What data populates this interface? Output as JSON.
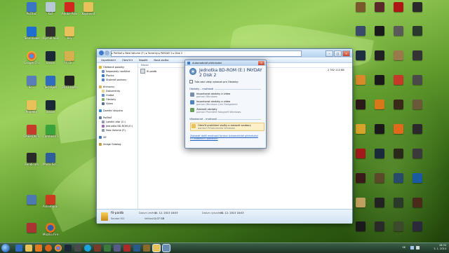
{
  "explorer": {
    "address": "▸ Počítač ▸ New Volume (F:) ▸ Torrenty ▸ PAYDAY 2 ▸ Disk 2",
    "commands": [
      "Uspořádat ▾",
      "Otevřít ▾",
      "Napálit",
      "Nová složka"
    ],
    "nav": [
      "Oblíbené položky",
      "Naposledy navštíve",
      "Plocha",
      "Stažené soubory",
      "Knihovny",
      "Dokumenty",
      "Hudba",
      "Obrázky",
      "Videa",
      "Domácí skupina",
      "Počítač",
      "Lokální disk (C:)",
      "Jednotka BD-ROM (E:)",
      "New Volume (F:)",
      "Síť",
      "Image Catalog"
    ],
    "column_name": "Název",
    "file_name": "fil-paidb",
    "size": "2 352 110 KB",
    "status": {
      "name": "fil-paidb",
      "modified_label": "Datum změny:",
      "modified": "31. 12. 2013 18:03",
      "created_label": "Datum vytvoření:",
      "created": "31. 12. 2013 18:03",
      "type_label": "Soubor ISO",
      "size_label": "Velikost:",
      "size": "2,07 GB"
    }
  },
  "autoplay": {
    "title": "Automatické přehrávání",
    "drive": "Jednotka BD-ROM (E:) PAYDAY 2 Disk 2",
    "always": "Tuto akci vždy vykonat pro Obrázky:",
    "section1": "Obrázky – možnosti",
    "options": [
      {
        "title": "Importovat obrázky a videa",
        "sub": "pomocí Windows"
      },
      {
        "title": "Importovat obrázky a videa",
        "sub": "pomocí Windows Live Fotogalerie"
      },
      {
        "title": "Zobrazit obrázky",
        "sub": "pomocí Prohlížeč fotografií Windows"
      }
    ],
    "section2": "Všeobecné – možnosti",
    "general": {
      "title": "Otevřít prohlížení složky a zobrazit soubory",
      "sub": "pomocí Průzkumníka Windows"
    },
    "link": "Zobrazit další možnosti funkce Automatické přehrávání v Ovládacích panelech"
  },
  "desktop_icons": [
    {
      "label": "Počítač"
    },
    {
      "label": "Koš"
    },
    {
      "label": "Adobe Reader"
    },
    {
      "label": "Kopírovat"
    },
    {
      "label": "TeamViewer"
    },
    {
      "label": "Rychlé hudby"
    },
    {
      "label": "Hry"
    },
    {
      "label": "Google Chrome"
    },
    {
      "label": "Steam"
    },
    {
      "label": "FC Dr..."
    },
    {
      "label": "Sc..."
    },
    {
      "label": "TechSpot"
    },
    {
      "label": "2013 klášter"
    },
    {
      "label": "Projekty"
    },
    {
      "label": "Steam"
    },
    {
      "label": "DAEMON Tools Pro"
    },
    {
      "label": "Camtasia Studio 8"
    },
    {
      "label": "Bandicam"
    },
    {
      "label": "Photo Scr..."
    },
    {
      "label": "Ashampoo Burning St."
    },
    {
      "label": "Mozilla Firefox"
    }
  ],
  "taskbar": {
    "lang": "SK",
    "time": "18:34",
    "date": "3. 1. 2014"
  }
}
